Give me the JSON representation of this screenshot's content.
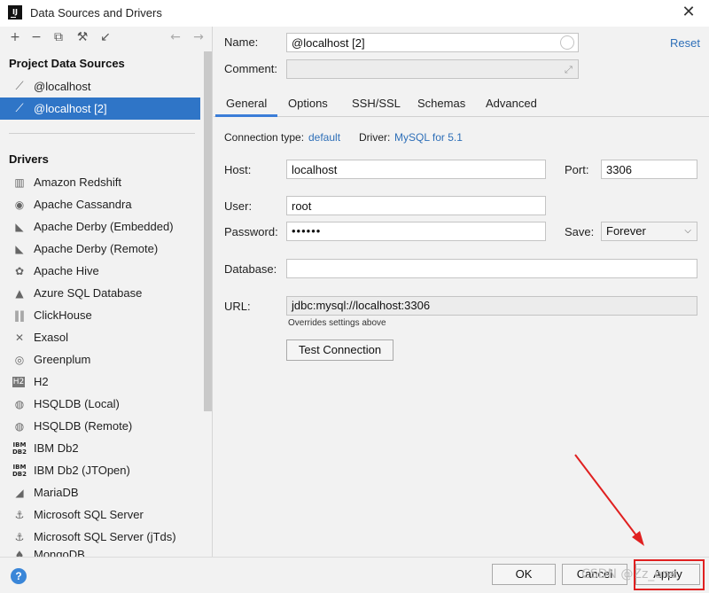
{
  "window": {
    "title": "Data Sources and Drivers"
  },
  "left": {
    "project_header": "Project Data Sources",
    "data_sources": [
      {
        "label": "@localhost",
        "icon": "mysql-dolphin-icon"
      },
      {
        "label": "@localhost [2]",
        "icon": "mysql-dolphin-icon",
        "selected": true
      }
    ],
    "drivers_header": "Drivers",
    "drivers": [
      {
        "label": "Amazon Redshift",
        "icon": "redshift-icon"
      },
      {
        "label": "Apache Cassandra",
        "icon": "cassandra-eye-icon"
      },
      {
        "label": "Apache Derby (Embedded)",
        "icon": "derby-hat-icon"
      },
      {
        "label": "Apache Derby (Remote)",
        "icon": "derby-hat-icon"
      },
      {
        "label": "Apache Hive",
        "icon": "hive-bee-icon"
      },
      {
        "label": "Azure SQL Database",
        "icon": "azure-icon"
      },
      {
        "label": "ClickHouse",
        "icon": "clickhouse-bars-icon"
      },
      {
        "label": "Exasol",
        "icon": "exasol-x-icon"
      },
      {
        "label": "Greenplum",
        "icon": "greenplum-circle-icon"
      },
      {
        "label": "H2",
        "icon": "h2-icon"
      },
      {
        "label": "HSQLDB (Local)",
        "icon": "hsqldb-icon"
      },
      {
        "label": "HSQLDB (Remote)",
        "icon": "hsqldb-icon"
      },
      {
        "label": "IBM Db2",
        "icon": "ibm-db2-icon"
      },
      {
        "label": "IBM Db2 (JTOpen)",
        "icon": "ibm-db2-icon"
      },
      {
        "label": "MariaDB",
        "icon": "mariadb-seal-icon"
      },
      {
        "label": "Microsoft SQL Server",
        "icon": "mssql-icon"
      },
      {
        "label": "Microsoft SQL Server (jTds)",
        "icon": "mssql-icon"
      },
      {
        "label": "MongoDB",
        "icon": "mongodb-leaf-icon"
      }
    ]
  },
  "form": {
    "name_label": "Name:",
    "name_value": "@localhost [2]",
    "reset_label": "Reset",
    "comment_label": "Comment:",
    "comment_value": "",
    "tabs": [
      "General",
      "Options",
      "SSH/SSL",
      "Schemas",
      "Advanced"
    ],
    "active_tab": "General",
    "connection_type_label": "Connection type:",
    "connection_type_value": "default",
    "driver_label": "Driver:",
    "driver_value": "MySQL for 5.1",
    "host_label": "Host:",
    "host_value": "localhost",
    "port_label": "Port:",
    "port_value": "3306",
    "user_label": "User:",
    "user_value": "root",
    "password_label": "Password:",
    "password_value": "••••••",
    "save_label": "Save:",
    "save_value": "Forever",
    "database_label": "Database:",
    "database_value": "",
    "url_label": "URL:",
    "url_value": "jdbc:mysql://localhost:3306",
    "url_note": "Overrides settings above",
    "test_connection_label": "Test Connection"
  },
  "bottom": {
    "ok_label": "OK",
    "cancel_label": "Cancel",
    "apply_label": "Apply",
    "watermark": "CSDN @Zz_one"
  },
  "annotation": {
    "color": "#e02020"
  }
}
